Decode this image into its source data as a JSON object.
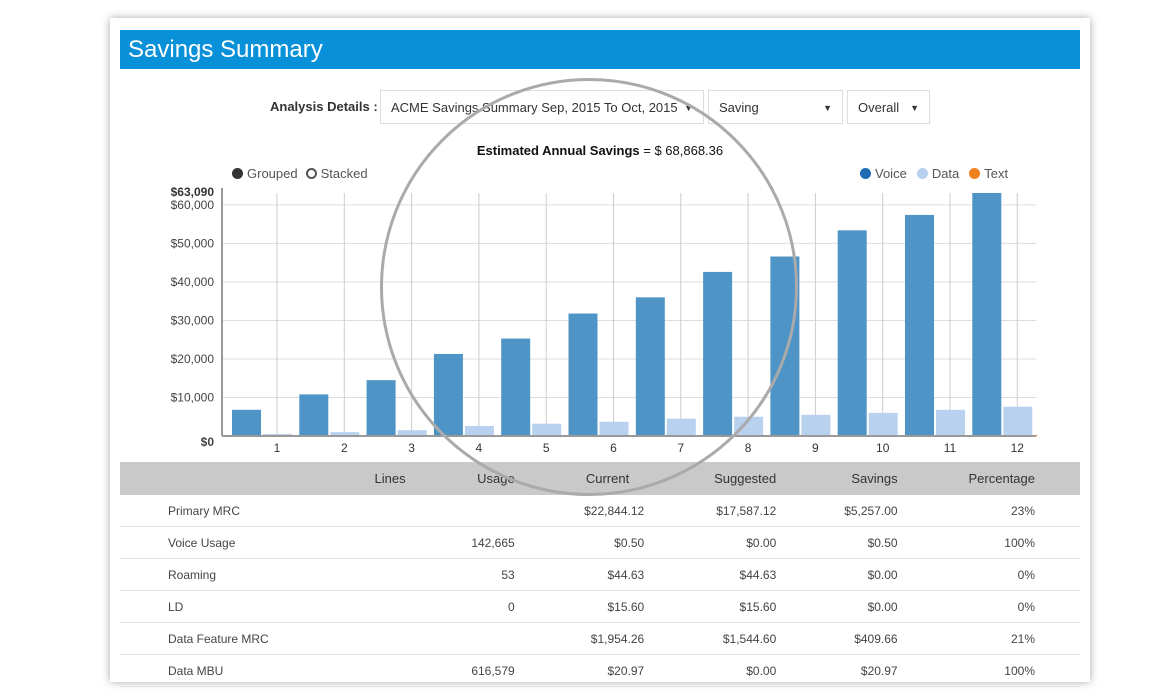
{
  "header": {
    "title": "Savings Summary"
  },
  "controls": {
    "label": "Analysis Details :",
    "analysis": "ACME Savings Summary Sep, 2015 To Oct, 2015",
    "metric": "Saving",
    "scope": "Overall"
  },
  "estimate": {
    "label": "Estimated Annual Savings",
    "value": "= $ 68,868.36"
  },
  "mode": {
    "grouped": "Grouped",
    "stacked": "Stacked",
    "selected": "Grouped"
  },
  "colors": {
    "voice": "#4f94c6",
    "data": "#b8d1ee",
    "text": "#f0821e",
    "header": "#0890d8"
  },
  "chart_data": {
    "type": "bar",
    "categories": [
      "1",
      "2",
      "3",
      "4",
      "5",
      "6",
      "7",
      "8",
      "9",
      "10",
      "11",
      "12"
    ],
    "series": [
      {
        "name": "Voice",
        "values": [
          6800,
          10800,
          14500,
          21300,
          25300,
          31800,
          36000,
          42600,
          46600,
          53400,
          57400,
          63090
        ]
      },
      {
        "name": "Data",
        "values": [
          500,
          1000,
          1500,
          2600,
          3200,
          3700,
          4500,
          5000,
          5500,
          6000,
          6800,
          7600
        ]
      },
      {
        "name": "Text",
        "values": [
          0,
          0,
          0,
          0,
          0,
          0,
          0,
          0,
          0,
          0,
          0,
          0
        ]
      }
    ],
    "yticks": [
      "$0",
      "$10,000",
      "$20,000",
      "$30,000",
      "$40,000",
      "$50,000",
      "$60,000",
      "$63,090"
    ],
    "ylim": [
      0,
      63090
    ],
    "grid": true,
    "legend": "top-right"
  },
  "table": {
    "headers": [
      "",
      "Lines",
      "Usage",
      "Current",
      "Suggested",
      "Savings",
      "Percentage"
    ],
    "rows": [
      [
        "Primary MRC",
        "",
        "",
        "$22,844.12",
        "$17,587.12",
        "$5,257.00",
        "23%"
      ],
      [
        "Voice Usage",
        "",
        "142,665",
        "$0.50",
        "$0.00",
        "$0.50",
        "100%"
      ],
      [
        "Roaming",
        "",
        "53",
        "$44.63",
        "$44.63",
        "$0.00",
        "0%"
      ],
      [
        "LD",
        "",
        "0",
        "$15.60",
        "$15.60",
        "$0.00",
        "0%"
      ],
      [
        "Data Feature MRC",
        "",
        "",
        "$1,954.26",
        "$1,544.60",
        "$409.66",
        "21%"
      ],
      [
        "Data MBU",
        "",
        "616,579",
        "$20.97",
        "$0.00",
        "$20.97",
        "100%"
      ]
    ]
  }
}
